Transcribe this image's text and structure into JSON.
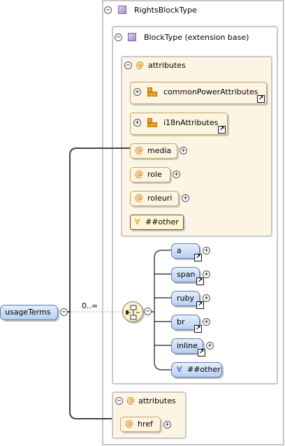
{
  "root_element": {
    "label": "usageTerms",
    "expand": "−"
  },
  "occurrence": "0..∞",
  "complex_type": {
    "label": "RightsBlockType",
    "expand": "−"
  },
  "extension_base": {
    "label": "BlockType (extension base)",
    "expand": "−"
  },
  "attributes_group": {
    "label": "attributes",
    "expand": "−",
    "groups": [
      {
        "label": "commonPowerAttributes",
        "expand": "+"
      },
      {
        "label": "i18nAttributes",
        "expand": "+"
      }
    ],
    "attributes": [
      {
        "label": "media",
        "expand": "+"
      },
      {
        "label": "role",
        "expand": "+"
      },
      {
        "label": "roleuri",
        "expand": "+"
      }
    ],
    "any_attribute": {
      "label": "##other",
      "symbol": "∀"
    }
  },
  "choice_compositor": {
    "expand": "−"
  },
  "choice_elements": [
    {
      "label": "a",
      "expand": "+"
    },
    {
      "label": "span",
      "expand": "+"
    },
    {
      "label": "ruby",
      "expand": "+"
    },
    {
      "label": "br",
      "expand": "+"
    },
    {
      "label": "inline",
      "expand": "+"
    }
  ],
  "any_element": {
    "label": "##other",
    "symbol": "∀"
  },
  "own_attributes": {
    "label": "attributes",
    "expand": "−",
    "attributes": [
      {
        "label": "href",
        "expand": "+"
      }
    ]
  },
  "icons": {
    "ref_arrow": "↗",
    "at": "@"
  },
  "colors": {
    "attribute_fill": "#fdf4e2",
    "element_fill": "#c9dbf5",
    "border": "#c8c8c8",
    "accent": "#e08b1b"
  }
}
